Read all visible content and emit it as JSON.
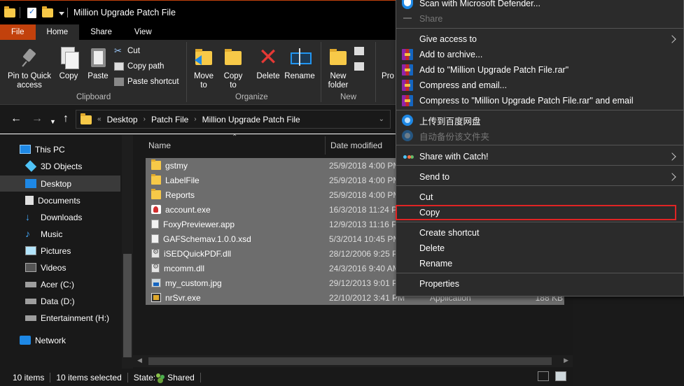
{
  "window": {
    "title": "Million Upgrade Patch File"
  },
  "tabs": [
    {
      "label": "File"
    },
    {
      "label": "Home"
    },
    {
      "label": "Share"
    },
    {
      "label": "View"
    }
  ],
  "ribbon": {
    "pin_label_1": "Pin to Quick",
    "pin_label_2": "access",
    "copy_label": "Copy",
    "paste_label": "Paste",
    "cut_label": "Cut",
    "copy_path_label": "Copy path",
    "paste_shortcut_label": "Paste shortcut",
    "clipboard_group": "Clipboard",
    "move_to_label": "Move",
    "move_to_label2": "to",
    "copy_to_label": "Copy",
    "copy_to_label2": "to",
    "delete_label": "Delete",
    "rename_label": "Rename",
    "organize_group": "Organize",
    "new_folder_label": "New",
    "new_folder_label2": "folder",
    "new_group": "New",
    "properties_partial": "Pro"
  },
  "address": {
    "overflow": "«",
    "crumbs": [
      "Desktop",
      "Patch File",
      "Million Upgrade Patch File"
    ]
  },
  "nav_pane": {
    "items": [
      {
        "label": "This PC",
        "icon": "pc-icon"
      },
      {
        "label": "3D Objects",
        "icon": "cube-icon"
      },
      {
        "label": "Desktop",
        "icon": "desktop-icon"
      },
      {
        "label": "Documents",
        "icon": "documents-icon"
      },
      {
        "label": "Downloads",
        "icon": "download-icon"
      },
      {
        "label": "Music",
        "icon": "music-icon"
      },
      {
        "label": "Pictures",
        "icon": "pictures-icon"
      },
      {
        "label": "Videos",
        "icon": "videos-icon"
      },
      {
        "label": "Acer (C:)",
        "icon": "drive-icon"
      },
      {
        "label": "Data (D:)",
        "icon": "drive-icon"
      },
      {
        "label": "Entertainment (H:)",
        "icon": "drive-icon"
      },
      {
        "label": "Network",
        "icon": "network-icon"
      }
    ]
  },
  "file_list": {
    "columns": {
      "name": "Name",
      "date": "Date modified"
    },
    "rows": [
      {
        "name": "gstmy",
        "date": "25/9/2018 4:00 PM",
        "type": "",
        "size": "",
        "icon": "folder-icon"
      },
      {
        "name": "LabelFile",
        "date": "25/9/2018 4:00 PM",
        "type": "",
        "size": "",
        "icon": "folder-icon"
      },
      {
        "name": "Reports",
        "date": "25/9/2018 4:00 PM",
        "type": "",
        "size": "",
        "icon": "folder-icon"
      },
      {
        "name": "account.exe",
        "date": "16/3/2018 11:24 P",
        "type": "",
        "size": "",
        "icon": "exe-icon"
      },
      {
        "name": "FoxyPreviewer.app",
        "date": "12/9/2013 11:16 P",
        "type": "",
        "size": "",
        "icon": "document-icon"
      },
      {
        "name": "GAFSchemav.1.0.0.xsd",
        "date": "5/3/2014 10:45 PM",
        "type": "",
        "size": "",
        "icon": "document-icon"
      },
      {
        "name": "iSEDQuickPDF.dll",
        "date": "28/12/2006 9:25 P",
        "type": "",
        "size": "",
        "icon": "dll-icon"
      },
      {
        "name": "mcomm.dll",
        "date": "24/3/2016 9:40 AM",
        "type": "",
        "size": "",
        "icon": "dll-icon"
      },
      {
        "name": "my_custom.jpg",
        "date": "29/12/2013 9:01 P",
        "type": "",
        "size": "",
        "icon": "image-icon"
      },
      {
        "name": "nrSvr.exe",
        "date": "22/10/2012 3:41 PM",
        "type": "Application",
        "size": "188 KB",
        "icon": "app-icon"
      }
    ]
  },
  "status": {
    "items": "10 items",
    "selected": "10 items selected",
    "state_label": "State:",
    "state_value": "Shared"
  },
  "context_menu": {
    "items": [
      {
        "label": "Scan with Microsoft Defender...",
        "icon": "defender-shield-icon"
      },
      {
        "label": "Share",
        "icon": "share-icon",
        "disabled": true
      },
      {
        "label": "Give access to",
        "submenu": true
      },
      {
        "label": "Add to archive...",
        "icon": "winrar-icon"
      },
      {
        "label": "Add to \"Million Upgrade Patch File.rar\"",
        "icon": "winrar-icon"
      },
      {
        "label": "Compress and email...",
        "icon": "winrar-icon"
      },
      {
        "label": "Compress to \"Million Upgrade Patch File.rar\" and email",
        "icon": "winrar-icon"
      },
      {
        "label": "上传到百度网盘",
        "icon": "baidu-cloud-icon"
      },
      {
        "label": "自动备份该文件夹",
        "icon": "baidu-cloud-icon",
        "disabled": true
      },
      {
        "label": "Share with Catch!",
        "icon": "catch-icon",
        "submenu": true
      },
      {
        "label": "Send to",
        "submenu": true
      },
      {
        "label": "Cut"
      },
      {
        "label": "Copy",
        "highlighted": true
      },
      {
        "label": "Create shortcut"
      },
      {
        "label": "Delete"
      },
      {
        "label": "Rename"
      },
      {
        "label": "Properties"
      }
    ],
    "highlight_color": "#e02424"
  },
  "colors": {
    "accent": "#c2410c",
    "selection": "#6d6d6d",
    "menu_bg": "#2b2b2b"
  }
}
